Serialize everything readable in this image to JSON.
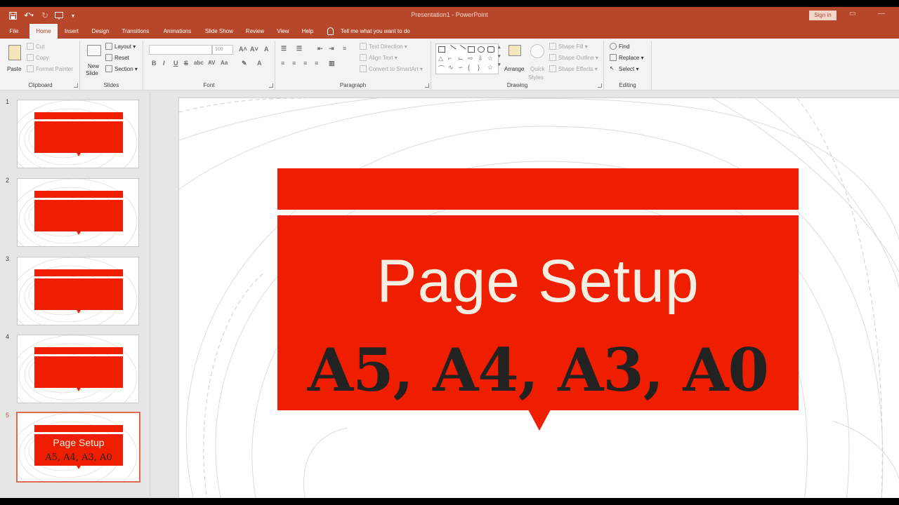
{
  "window": {
    "title": "Presentation1  -  PowerPoint",
    "sign_in": "Sign in"
  },
  "tabs": [
    "File",
    "Home",
    "Insert",
    "Design",
    "Transitions",
    "Animations",
    "Slide Show",
    "Review",
    "View",
    "Help"
  ],
  "active_tab": "Home",
  "tell_me": "Tell me what you want to do",
  "ribbon": {
    "clipboard": {
      "label": "Clipboard",
      "paste": "Paste",
      "cut": "Cut",
      "copy": "Copy",
      "format_painter": "Format Painter"
    },
    "slides": {
      "label": "Slides",
      "new_slide_1": "New",
      "new_slide_2": "Slide",
      "layout": "Layout",
      "reset": "Reset",
      "section": "Section"
    },
    "font": {
      "label": "Font",
      "size": "100",
      "bold": "B",
      "italic": "I",
      "underline": "U",
      "strike": "S",
      "shadow": "abc",
      "spacing": "AV",
      "case": "Aa"
    },
    "paragraph": {
      "label": "Paragraph",
      "text_direction": "Text Direction",
      "align_text": "Align Text",
      "convert_smartart": "Convert to SmartArt"
    },
    "drawing": {
      "label": "Drawing",
      "arrange": "Arrange",
      "quick_styles_1": "Quick",
      "quick_styles_2": "Styles",
      "shape_fill": "Shape Fill",
      "shape_outline": "Shape Outline",
      "shape_effects": "Shape Effects"
    },
    "editing": {
      "label": "Editing",
      "find": "Find",
      "replace": "Replace",
      "select": "Select"
    }
  },
  "slides": [
    {
      "number": "1"
    },
    {
      "number": "2"
    },
    {
      "number": "3"
    },
    {
      "number": "4"
    },
    {
      "number": "5",
      "title": "Page Setup",
      "subtitle": "A5, A4, A3, A0"
    }
  ],
  "selected_slide": "5",
  "current_slide": {
    "title": "Page Setup",
    "subtitle": "A5, A4, A3, A0"
  },
  "colors": {
    "accent": "#b7472a",
    "slide_red": "#f01e00"
  }
}
